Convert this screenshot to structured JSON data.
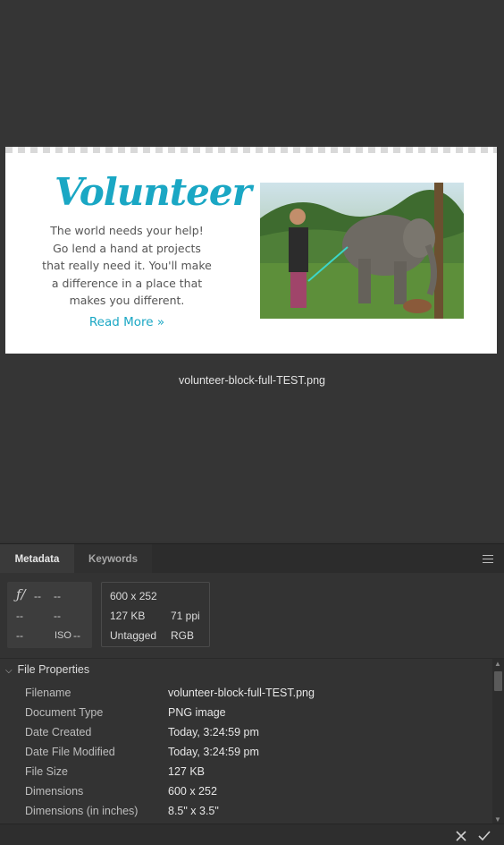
{
  "preview": {
    "filename": "volunteer-block-full-TEST.png",
    "thumbnail": {
      "title": "Volunteer",
      "blurb": "The world needs your help! Go lend a hand at projects that really need it. You'll make a difference in a place that makes you different.",
      "link": "Read More »",
      "accent_color": "#1aa7c4"
    }
  },
  "tabs": [
    {
      "label": "Metadata",
      "active": true
    },
    {
      "label": "Keywords",
      "active": false
    }
  ],
  "camera_info": {
    "aperture_icon": "f-stop-icon",
    "aperture": "--",
    "shutter": "--",
    "c1": "--",
    "c2": "--",
    "c3": "--",
    "iso_label": "ISO",
    "iso": "--"
  },
  "file_info": {
    "dimensions": "600 x 252",
    "size": "127 KB",
    "resolution": "71 ppi",
    "profile": "Untagged",
    "mode": "RGB"
  },
  "section": {
    "title": "File Properties",
    "rows": [
      {
        "label": "Filename",
        "value": "volunteer-block-full-TEST.png"
      },
      {
        "label": "Document Type",
        "value": "PNG image"
      },
      {
        "label": "Date Created",
        "value": "Today, 3:24:59 pm"
      },
      {
        "label": "Date File Modified",
        "value": "Today, 3:24:59 pm"
      },
      {
        "label": "File Size",
        "value": "127 KB"
      },
      {
        "label": "Dimensions",
        "value": "600 x 252"
      },
      {
        "label": "Dimensions (in inches)",
        "value": "8.5\" x 3.5\""
      }
    ]
  }
}
